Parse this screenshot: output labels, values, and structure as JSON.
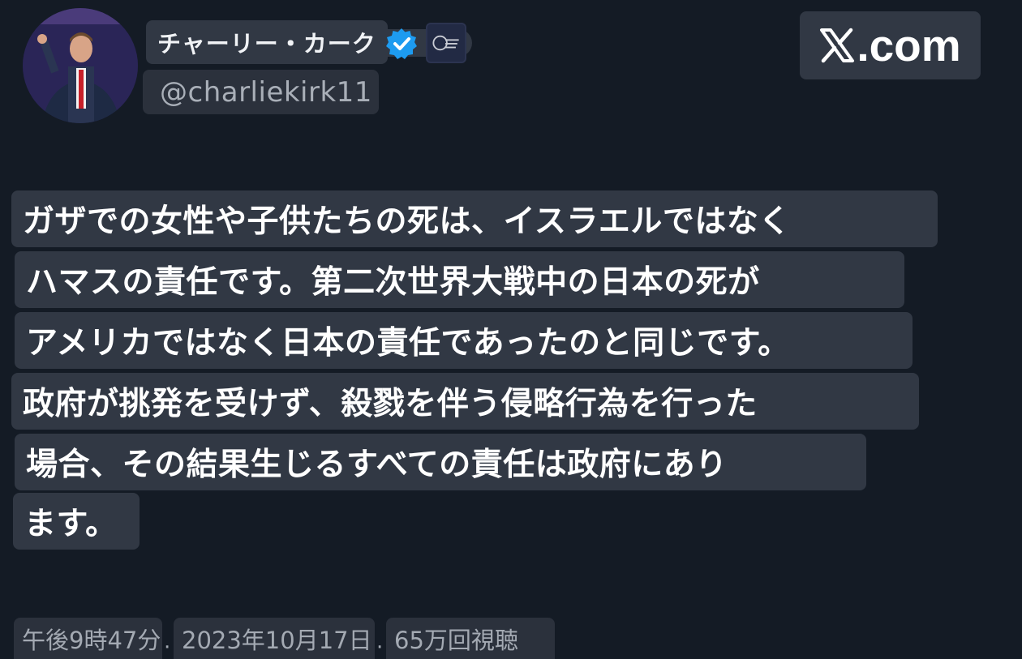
{
  "author": {
    "display_name": "チャーリー・カーク",
    "handle": "@charliekirk11"
  },
  "header": {
    "site_label": ".com",
    "logo_icon": "x-logo-icon"
  },
  "tweet": {
    "lines": [
      "ガザでの女性や子供たちの死は、イスラエルではなく",
      "ハマスの責任です。第二次世界大戦中の日本の死が",
      "アメリカではなく日本の責任であったのと同じです。",
      "政府が挑発を受けず、殺戮を伴う侵略行為を行った",
      "場合、その結果生じるすべての責任は政府にあり",
      "ます。"
    ]
  },
  "meta": {
    "time": "午後9時47分",
    "date": "2023年10月17日",
    "views": "65万回視聴",
    "separator": "·"
  },
  "colors": {
    "background": "#141b25",
    "chip": "#313844",
    "verified": "#1d9bf0"
  }
}
